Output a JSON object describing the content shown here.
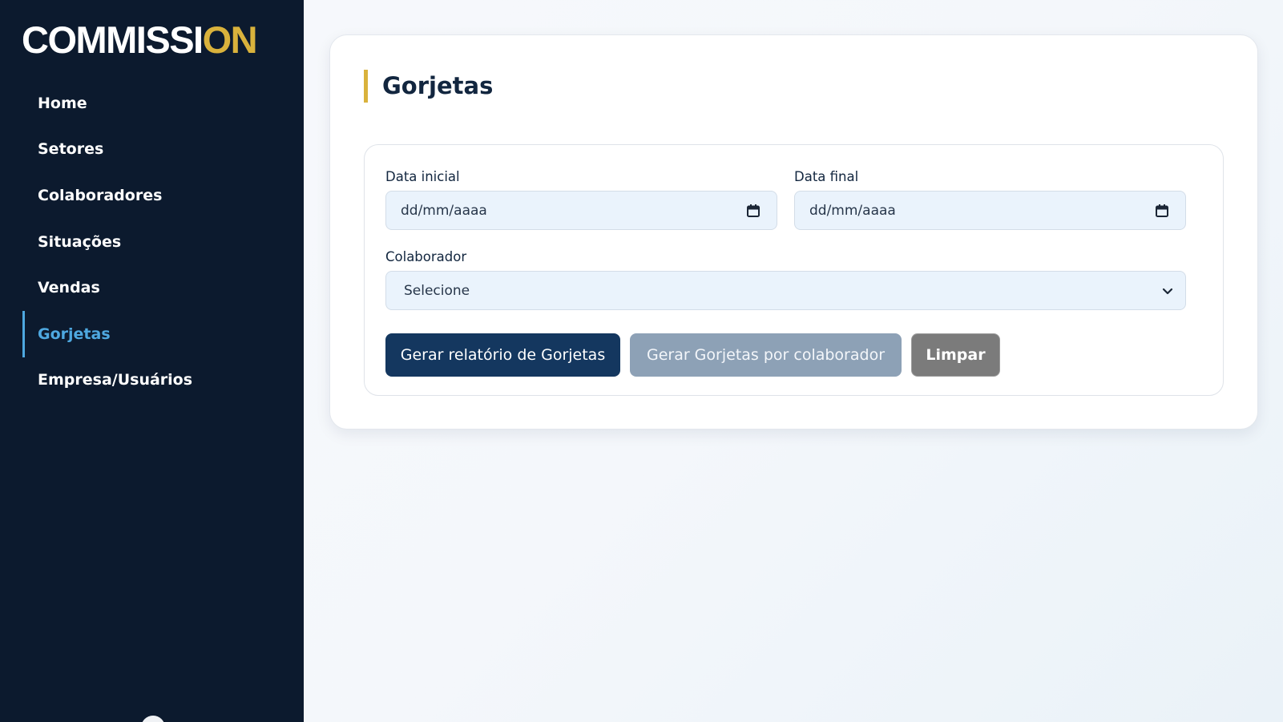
{
  "sidebar": {
    "logo": {
      "main": "COMMISSI",
      "accent": "ON"
    },
    "items": [
      {
        "label": "Home"
      },
      {
        "label": "Setores"
      },
      {
        "label": "Colaboradores"
      },
      {
        "label": "Situações"
      },
      {
        "label": "Vendas"
      },
      {
        "label": "Gorjetas",
        "active": true
      },
      {
        "label": "Empresa/Usuários"
      }
    ]
  },
  "main": {
    "title": "Gorjetas",
    "form": {
      "start_date": {
        "label": "Data inicial",
        "placeholder": "dd/mm/aaaa",
        "icon": "calendar-icon"
      },
      "end_date": {
        "label": "Data final",
        "placeholder": "dd/mm/aaaa",
        "icon": "calendar-icon"
      },
      "collaborator": {
        "label": "Colaborador",
        "selected": "Selecione",
        "icon": "chevron-down-icon"
      }
    },
    "buttons": {
      "generate_report": "Gerar relatório de Gorjetas",
      "generate_by_collaborator": "Gerar Gorjetas por colaborador",
      "clear": "Limpar"
    }
  },
  "colors": {
    "sidebar_bg": "#0c1a2e",
    "accent_gold": "#d9b23c",
    "active_blue": "#4ea8e0",
    "primary_button": "#14375f",
    "secondary_button": "#8da1b6",
    "clear_button": "#7b7b7b",
    "input_bg": "#eaf3fc"
  }
}
